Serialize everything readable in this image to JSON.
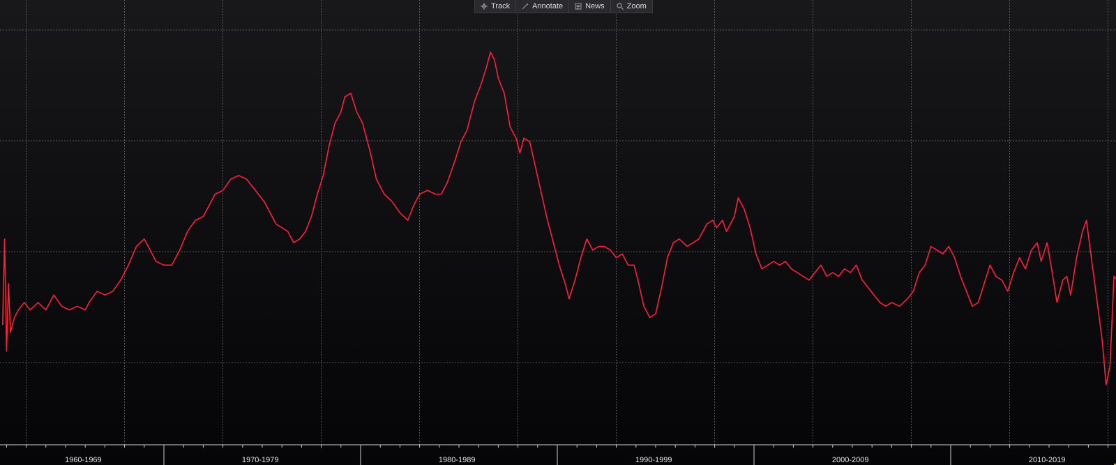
{
  "toolbar": {
    "items": [
      {
        "label": "Track",
        "icon": "crosshair-icon"
      },
      {
        "label": "Annotate",
        "icon": "pencil-icon"
      },
      {
        "label": "News",
        "icon": "news-icon"
      },
      {
        "label": "Zoom",
        "icon": "zoom-icon"
      }
    ]
  },
  "colors": {
    "line": "#ff1e3c",
    "grid": "#6a6a6a",
    "axis": "#cfcfcf",
    "highlight": "#e8b100"
  },
  "chart_data": {
    "type": "line",
    "grid": true,
    "legend": "none",
    "title": "",
    "xlabel": "",
    "ylabel": "",
    "xlim": [
      1960.0,
      2017.0
    ],
    "ylim": [
      0.0,
      100.0
    ],
    "x_tick_labels": [
      "1960-1969",
      "1970-1979",
      "1980-1989",
      "1990-1999",
      "2000-2009",
      "2010-2019"
    ],
    "series": [
      {
        "name": "",
        "points": [
          [
            1956.8,
            22
          ],
          [
            1956.9,
            45
          ],
          [
            1957.0,
            15
          ],
          [
            1957.1,
            33
          ],
          [
            1957.2,
            20
          ],
          [
            1957.4,
            24
          ],
          [
            1957.6,
            26
          ],
          [
            1957.9,
            28
          ],
          [
            1958.2,
            26
          ],
          [
            1958.6,
            28
          ],
          [
            1959.0,
            26
          ],
          [
            1959.4,
            30
          ],
          [
            1959.8,
            27
          ],
          [
            1960.2,
            26
          ],
          [
            1960.6,
            27
          ],
          [
            1961.0,
            26
          ],
          [
            1961.2,
            28
          ],
          [
            1961.6,
            31
          ],
          [
            1962.0,
            30
          ],
          [
            1962.4,
            31
          ],
          [
            1962.8,
            34
          ],
          [
            1963.2,
            38
          ],
          [
            1963.6,
            43
          ],
          [
            1964.0,
            45
          ],
          [
            1964.3,
            42
          ],
          [
            1964.6,
            39
          ],
          [
            1965.0,
            38
          ],
          [
            1965.4,
            38
          ],
          [
            1965.8,
            42
          ],
          [
            1966.2,
            47
          ],
          [
            1966.6,
            50
          ],
          [
            1967.0,
            51
          ],
          [
            1967.3,
            54
          ],
          [
            1967.6,
            57
          ],
          [
            1968.0,
            58
          ],
          [
            1968.4,
            61
          ],
          [
            1968.8,
            62
          ],
          [
            1969.2,
            61
          ],
          [
            1969.5,
            59
          ],
          [
            1969.8,
            57
          ],
          [
            1970.1,
            55
          ],
          [
            1970.4,
            52
          ],
          [
            1970.7,
            49
          ],
          [
            1971.0,
            48
          ],
          [
            1971.3,
            47
          ],
          [
            1971.6,
            44
          ],
          [
            1971.9,
            45
          ],
          [
            1972.2,
            47
          ],
          [
            1972.5,
            51
          ],
          [
            1972.8,
            57
          ],
          [
            1973.1,
            62
          ],
          [
            1973.4,
            70
          ],
          [
            1973.7,
            76
          ],
          [
            1974.0,
            79
          ],
          [
            1974.2,
            83
          ],
          [
            1974.5,
            84
          ],
          [
            1974.8,
            79
          ],
          [
            1975.1,
            76
          ],
          [
            1975.5,
            68
          ],
          [
            1975.8,
            61
          ],
          [
            1976.2,
            57
          ],
          [
            1976.6,
            55
          ],
          [
            1977.0,
            52
          ],
          [
            1977.4,
            50
          ],
          [
            1977.7,
            54
          ],
          [
            1978.0,
            57
          ],
          [
            1978.4,
            58
          ],
          [
            1978.8,
            57
          ],
          [
            1979.1,
            57
          ],
          [
            1979.4,
            60
          ],
          [
            1979.8,
            66
          ],
          [
            1980.1,
            71
          ],
          [
            1980.4,
            74
          ],
          [
            1980.8,
            82
          ],
          [
            1981.1,
            86
          ],
          [
            1981.4,
            91
          ],
          [
            1981.6,
            95
          ],
          [
            1981.8,
            93
          ],
          [
            1982.0,
            88
          ],
          [
            1982.3,
            84
          ],
          [
            1982.6,
            75
          ],
          [
            1982.9,
            72
          ],
          [
            1983.1,
            68
          ],
          [
            1983.3,
            72
          ],
          [
            1983.6,
            71
          ],
          [
            1983.9,
            64
          ],
          [
            1984.2,
            57
          ],
          [
            1984.5,
            50
          ],
          [
            1984.8,
            44
          ],
          [
            1985.1,
            38
          ],
          [
            1985.4,
            33
          ],
          [
            1985.6,
            29
          ],
          [
            1985.9,
            34
          ],
          [
            1986.2,
            40
          ],
          [
            1986.5,
            45
          ],
          [
            1986.8,
            42
          ],
          [
            1987.1,
            43
          ],
          [
            1987.4,
            43
          ],
          [
            1987.7,
            42
          ],
          [
            1988.0,
            40
          ],
          [
            1988.3,
            41
          ],
          [
            1988.6,
            38
          ],
          [
            1988.9,
            38
          ],
          [
            1989.1,
            34
          ],
          [
            1989.4,
            27
          ],
          [
            1989.7,
            24
          ],
          [
            1990.0,
            25
          ],
          [
            1990.3,
            32
          ],
          [
            1990.6,
            40
          ],
          [
            1990.9,
            44
          ],
          [
            1991.2,
            45
          ],
          [
            1991.6,
            43
          ],
          [
            1991.9,
            44
          ],
          [
            1992.2,
            45
          ],
          [
            1992.6,
            49
          ],
          [
            1992.9,
            50
          ],
          [
            1993.1,
            48
          ],
          [
            1993.4,
            50
          ],
          [
            1993.6,
            47
          ],
          [
            1994.0,
            51
          ],
          [
            1994.2,
            56
          ],
          [
            1994.5,
            53
          ],
          [
            1994.8,
            48
          ],
          [
            1995.1,
            41
          ],
          [
            1995.4,
            37
          ],
          [
            1995.7,
            38
          ],
          [
            1996.0,
            39
          ],
          [
            1996.3,
            38
          ],
          [
            1996.6,
            39
          ],
          [
            1996.9,
            37
          ],
          [
            1997.2,
            36
          ],
          [
            1997.5,
            35
          ],
          [
            1997.8,
            34
          ],
          [
            1998.1,
            36
          ],
          [
            1998.4,
            38
          ],
          [
            1998.7,
            35
          ],
          [
            1999.0,
            36
          ],
          [
            1999.3,
            35
          ],
          [
            1999.6,
            37
          ],
          [
            1999.9,
            36
          ],
          [
            2000.2,
            38
          ],
          [
            2000.5,
            34
          ],
          [
            2000.8,
            32
          ],
          [
            2001.1,
            30
          ],
          [
            2001.4,
            28
          ],
          [
            2001.7,
            27
          ],
          [
            2002.0,
            28
          ],
          [
            2002.4,
            27
          ],
          [
            2002.8,
            29
          ],
          [
            2003.1,
            31
          ],
          [
            2003.4,
            36
          ],
          [
            2003.7,
            38
          ],
          [
            2004.0,
            43
          ],
          [
            2004.3,
            42
          ],
          [
            2004.6,
            41
          ],
          [
            2004.9,
            43
          ],
          [
            2005.2,
            40
          ],
          [
            2005.5,
            35
          ],
          [
            2005.8,
            31
          ],
          [
            2006.1,
            27
          ],
          [
            2006.4,
            28
          ],
          [
            2006.7,
            33
          ],
          [
            2007.0,
            38
          ],
          [
            2007.3,
            35
          ],
          [
            2007.6,
            34
          ],
          [
            2007.9,
            31
          ],
          [
            2008.2,
            36
          ],
          [
            2008.5,
            40
          ],
          [
            2008.8,
            37
          ],
          [
            2009.1,
            42
          ],
          [
            2009.4,
            44
          ],
          [
            2009.6,
            39
          ],
          [
            2009.9,
            44
          ],
          [
            2010.1,
            38
          ],
          [
            2010.4,
            28
          ],
          [
            2010.7,
            34
          ],
          [
            2010.9,
            35
          ],
          [
            2011.1,
            30
          ],
          [
            2011.4,
            40
          ],
          [
            2011.7,
            47
          ],
          [
            2011.9,
            50
          ],
          [
            2012.1,
            42
          ],
          [
            2012.4,
            30
          ],
          [
            2012.7,
            18
          ],
          [
            2012.9,
            6
          ],
          [
            2013.1,
            11
          ],
          [
            2013.3,
            35
          ],
          [
            2013.6,
            33
          ],
          [
            2013.9,
            27
          ],
          [
            2014.2,
            27
          ],
          [
            2014.5,
            33
          ],
          [
            2014.8,
            38
          ],
          [
            2015.0,
            41
          ],
          [
            2015.3,
            42
          ],
          [
            2015.6,
            38
          ],
          [
            2015.9,
            35
          ],
          [
            2016.2,
            28
          ],
          [
            2016.5,
            27
          ],
          [
            2016.8,
            30
          ],
          [
            2017.1,
            28
          ]
        ]
      }
    ]
  }
}
